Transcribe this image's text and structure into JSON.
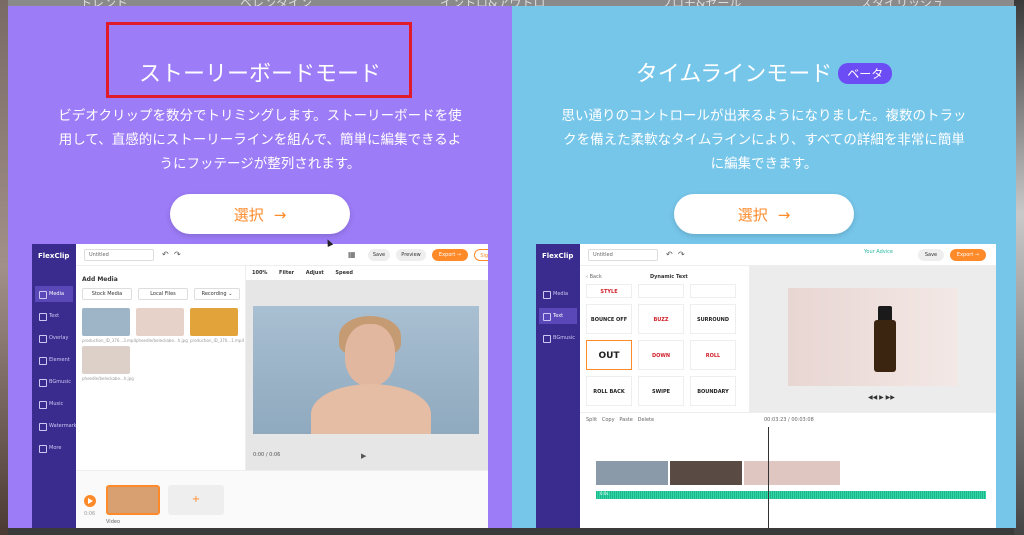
{
  "background_tabs": [
    "トレンド",
    "ベレンタイン",
    "イントロ&アウトロ",
    "プロモ&セール",
    "スタイリッシュ"
  ],
  "left_panel": {
    "title": "ストーリーボードモード",
    "description_lines": [
      "ビデオクリップを数分でトリミングします。ストーリーボードを使",
      "用して、直感的にストーリーラインを組んで、簡単に編集できるよ",
      "うにフッテージが整列されます。"
    ],
    "select_label": "選択",
    "select_arrow": "→",
    "accent": "#9d7cf7",
    "highlight_color": "#e21b2a",
    "mock": {
      "logo": "FlexClip",
      "project_name": "Untitled",
      "top_buttons": {
        "save": "Save",
        "preview": "Preview",
        "export": "Export →",
        "signup": "Sign Up"
      },
      "sidebar": [
        "Media",
        "Text",
        "Overlay",
        "Element",
        "BGmusic",
        "Music",
        "Watermark",
        "More"
      ],
      "add_media": "Add Media",
      "media_buttons": [
        "Stock Media",
        "Local Files",
        "Recording ⌄"
      ],
      "thumb_labels": [
        "production_ID_376...3.mp4",
        "pheedle/beleckabe...h.jpg",
        "production_ID_376...1.mp4",
        "pheedle/beleckabe...h.jpg"
      ],
      "tool_labels": [
        "100%",
        "Filter",
        "Adjust",
        "Speed"
      ],
      "time": "0:00 / 0:06",
      "clip_label": "Video",
      "clip_duration": "0:06",
      "add_icon": "+"
    }
  },
  "right_panel": {
    "title": "タイムラインモード",
    "badge": "ベータ",
    "description_lines": [
      "思い通りのコントロールが出来るようになりました。複数のトラッ",
      "クを備えた柔軟なタイムラインにより、すべての詳細を非常に簡単",
      "に編集できます。"
    ],
    "select_label": "選択",
    "select_arrow": "→",
    "accent": "#76c6ea",
    "mock": {
      "logo": "FlexClip",
      "project_name": "Untitled",
      "advice": "Your Advice",
      "top_buttons": {
        "save": "Save",
        "export": "Export →"
      },
      "sidebar": [
        "Media",
        "Text",
        "BGmusic"
      ],
      "back": "‹ Back",
      "panel_title": "Dynamic Text",
      "tiles": [
        "STYLE",
        "",
        "",
        "BOUNCE OFF",
        "BUZZ",
        "SURROUND",
        "OUT",
        "DOWN",
        "ROLL",
        "ROLL BACK",
        "SWIPE",
        "BOUNDARY LEFT"
      ],
      "timeline_tools": [
        "Split",
        "Copy",
        "Paste",
        "Delete"
      ],
      "timecode": "00:03:23 / 00:03:08",
      "audio_label": "0.0s"
    }
  }
}
